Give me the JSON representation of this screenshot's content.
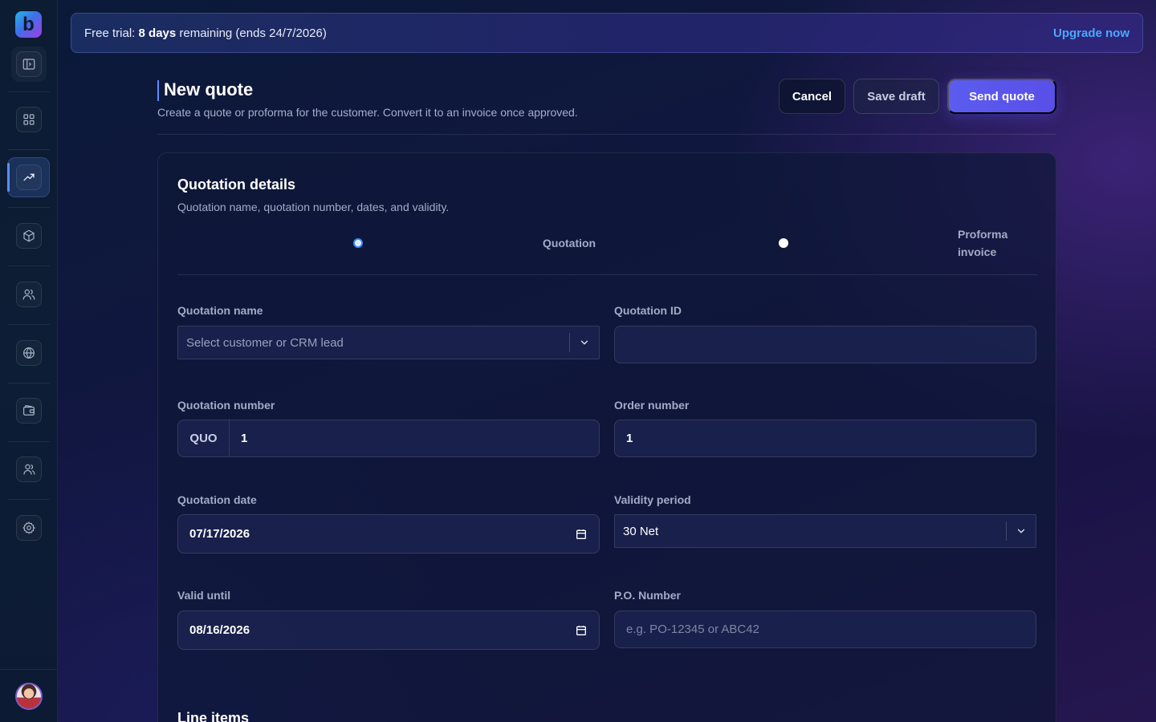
{
  "sidebar": {
    "logo_letter": "b",
    "nav_items": [
      {
        "name": "dashboard",
        "icon": "grid-icon"
      },
      {
        "name": "sales",
        "icon": "trend-up-icon",
        "active": true
      },
      {
        "name": "products",
        "icon": "cube-icon"
      },
      {
        "name": "contacts",
        "icon": "users-icon"
      },
      {
        "name": "web",
        "icon": "globe-icon"
      },
      {
        "name": "wallet",
        "icon": "wallet-icon"
      },
      {
        "name": "team",
        "icon": "team-icon"
      },
      {
        "name": "settings",
        "icon": "gear-icon"
      }
    ]
  },
  "banner": {
    "prefix": "Free trial: ",
    "days": "8 days",
    "suffix": " remaining (ends 24/7/2026)",
    "upgrade_label": "Upgrade now"
  },
  "header": {
    "title": "New quote",
    "subtitle": "Create a quote or proforma for the customer. Convert it to an invoice once approved.",
    "cancel_label": "Cancel",
    "save_draft_label": "Save draft",
    "send_label": "Send quote"
  },
  "card": {
    "title": "Quotation details",
    "subtitle": "Quotation name, quotation number, dates, and validity.",
    "doc_type": {
      "options": [
        "Quotation",
        "Proforma invoice"
      ],
      "selected": "Quotation"
    },
    "fields": {
      "quotation_name": {
        "label": "Quotation name",
        "placeholder": "Select customer or CRM lead"
      },
      "quotation_id": {
        "label": "Quotation ID",
        "value": ""
      },
      "quotation_number": {
        "label": "Quotation number",
        "prefix": "QUO",
        "value": "1"
      },
      "order_number": {
        "label": "Order number",
        "value": "1"
      },
      "quotation_date": {
        "label": "Quotation date",
        "value": "07/17/2026"
      },
      "validity_period": {
        "label": "Validity period",
        "value": "30 Net"
      },
      "valid_until": {
        "label": "Valid until",
        "value": "08/16/2026"
      },
      "po_number": {
        "label": "P.O. Number",
        "placeholder": "e.g. PO-12345 or ABC42"
      }
    },
    "line_items_title": "Line items"
  },
  "colors": {
    "accent": "#5b5cf0",
    "link": "#4aa8ff",
    "active_indicator": "#5b8cff"
  }
}
